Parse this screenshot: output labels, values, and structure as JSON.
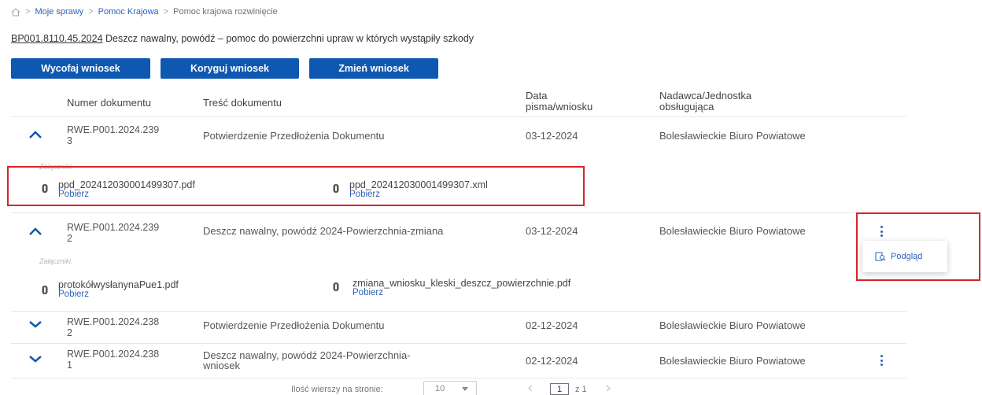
{
  "breadcrumb": {
    "items": [
      "Moje sprawy",
      "Pomoc Krajowa",
      "Pomoc krajowa rozwinięcie"
    ],
    "separator": ">"
  },
  "case": {
    "id": "BP001.8110.45.2024",
    "description": "Deszcz nawalny, powódź – pomoc do powierzchni upraw w których wystąpiły szkody"
  },
  "actions": {
    "withdraw": "Wycofaj wniosek",
    "correct": "Koryguj wniosek",
    "change": "Zmień wniosek"
  },
  "table": {
    "headers": {
      "number": "Numer dokumentu",
      "content": "Treść dokumentu",
      "date_line1": "Data",
      "date_line2": "pisma/wniosku",
      "sender_line1": "Nadawca/Jednostka",
      "sender_line2": "obsługująca"
    },
    "attachments_label": "Załączniki:",
    "download_label": "Pobierz",
    "rows": [
      {
        "num_line1": "RWE.P001.2024.239",
        "num_line2": "3",
        "content": "Potwierdzenie Przedłożenia Dokumentu",
        "date": "03-12-2024",
        "sender": "Bolesławieckie Biuro Powiatowe",
        "expanded": true,
        "attachments": [
          "ppd_202412030001499307.pdf",
          "ppd_202412030001499307.xml"
        ]
      },
      {
        "num_line1": "RWE.P001.2024.239",
        "num_line2": "2",
        "content": "Deszcz nawalny, powódź 2024-Powierzchnia-zmiana",
        "date": "03-12-2024",
        "sender": "Bolesławieckie Biuro Powiatowe",
        "expanded": true,
        "attachments": [
          "protokółwysłanynaPue1.pdf",
          "zmiana_wniosku_kleski_deszcz_powierzchnie.pdf"
        ]
      },
      {
        "num_line1": "RWE.P001.2024.238",
        "num_line2": "2",
        "content": "Potwierdzenie Przedłożenia Dokumentu",
        "date": "02-12-2024",
        "sender": "Bolesławieckie Biuro Powiatowe",
        "expanded": false
      },
      {
        "num_line1": "RWE.P001.2024.238",
        "num_line2": "1",
        "content_line1": "Deszcz nawalny, powódź 2024-Powierzchnia-",
        "content_line2": "wniosek",
        "date": "02-12-2024",
        "sender": "Bolesławieckie Biuro Powiatowe",
        "expanded": false
      }
    ]
  },
  "popup": {
    "preview": "Podgląd"
  },
  "pagination": {
    "rows_label": "Ilość wierszy na stronie:",
    "rows_value": "10",
    "page": "1",
    "of_label": "z 1"
  },
  "colors": {
    "primary": "#0e58b1",
    "link": "#2a62b8",
    "highlight": "#d6262b"
  }
}
